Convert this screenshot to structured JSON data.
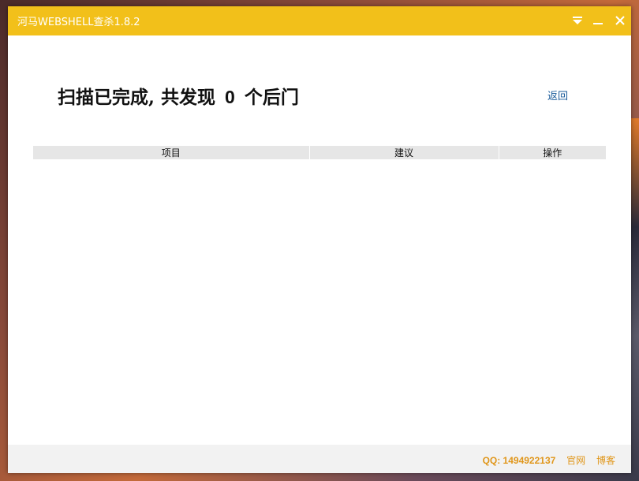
{
  "window": {
    "title": "河马WEBSHELL查杀1.8.2",
    "accent_color": "#f2c01a",
    "controls": [
      "menu-dropdown-icon",
      "minimize-icon",
      "close-icon"
    ]
  },
  "result": {
    "heading_prefix": "扫描已完成, 共发现",
    "count": "0",
    "heading_suffix": "个后门",
    "back_label": "返回"
  },
  "table": {
    "columns": [
      "项目",
      "建议",
      "操作"
    ],
    "rows": []
  },
  "footer": {
    "qq": "QQ: 1494922137",
    "official_site": "官网",
    "blog": "博客",
    "link_color": "#e0961a"
  }
}
